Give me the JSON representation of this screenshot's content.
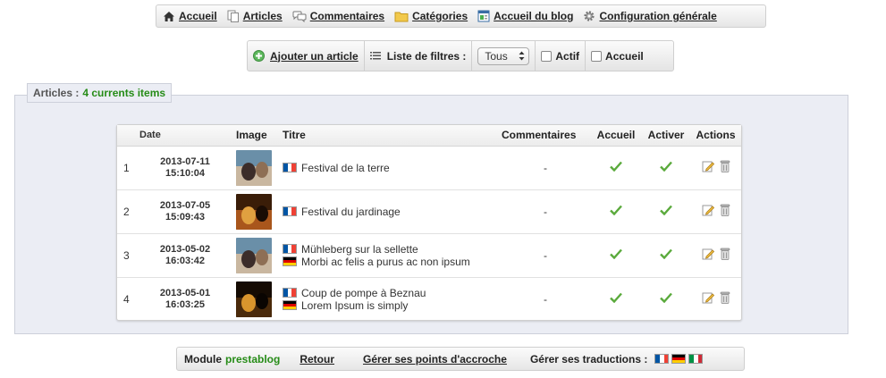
{
  "nav": {
    "items": [
      {
        "label": "Accueil",
        "icon": "home-icon"
      },
      {
        "label": "Articles",
        "icon": "pages-icon"
      },
      {
        "label": "Commentaires",
        "icon": "comments-icon"
      },
      {
        "label": "Catégories",
        "icon": "folder-icon"
      },
      {
        "label": "Accueil du blog",
        "icon": "blog-home-icon"
      },
      {
        "label": "Configuration générale",
        "icon": "gear-icon"
      }
    ]
  },
  "toolbar": {
    "add_label": "Ajouter un article",
    "filter_label": "Liste de filtres :",
    "filter_value": "Tous",
    "active_label": "Actif",
    "home_label": "Accueil"
  },
  "panel": {
    "legend_label": "Articles :",
    "legend_count": "4 currents items"
  },
  "table": {
    "headers": {
      "date": "Date",
      "image": "Image",
      "title": "Titre",
      "comments": "Commentaires",
      "home": "Accueil",
      "activate": "Activer",
      "actions": "Actions"
    },
    "rows": [
      {
        "num": "1",
        "date": "2013-07-11",
        "time": "15:10:04",
        "comments": "-",
        "titles": [
          {
            "lang": "fr",
            "text": "Festival de la terre"
          }
        ]
      },
      {
        "num": "2",
        "date": "2013-07-05",
        "time": "15:09:43",
        "comments": "-",
        "titles": [
          {
            "lang": "fr",
            "text": "Festival du jardinage"
          }
        ]
      },
      {
        "num": "3",
        "date": "2013-05-02",
        "time": "16:03:42",
        "comments": "-",
        "titles": [
          {
            "lang": "fr",
            "text": "Mühleberg sur la sellette"
          },
          {
            "lang": "de",
            "text": "Morbi ac felis a purus ac non ipsum"
          }
        ]
      },
      {
        "num": "4",
        "date": "2013-05-01",
        "time": "16:03:25",
        "comments": "-",
        "titles": [
          {
            "lang": "fr",
            "text": "Coup de pompe à Beznau"
          },
          {
            "lang": "de",
            "text": "Lorem Ipsum is simply"
          }
        ]
      }
    ]
  },
  "footer": {
    "module_label": "Module",
    "module_name": "prestablog",
    "back_label": "Retour",
    "hooks_label": "Gérer ses points d'accroche",
    "translations_label": "Gérer ses traductions :"
  },
  "colors": {
    "accent_green": "#268c17",
    "panel_bg": "#ebedf4",
    "check_green": "#5aaa3c"
  }
}
